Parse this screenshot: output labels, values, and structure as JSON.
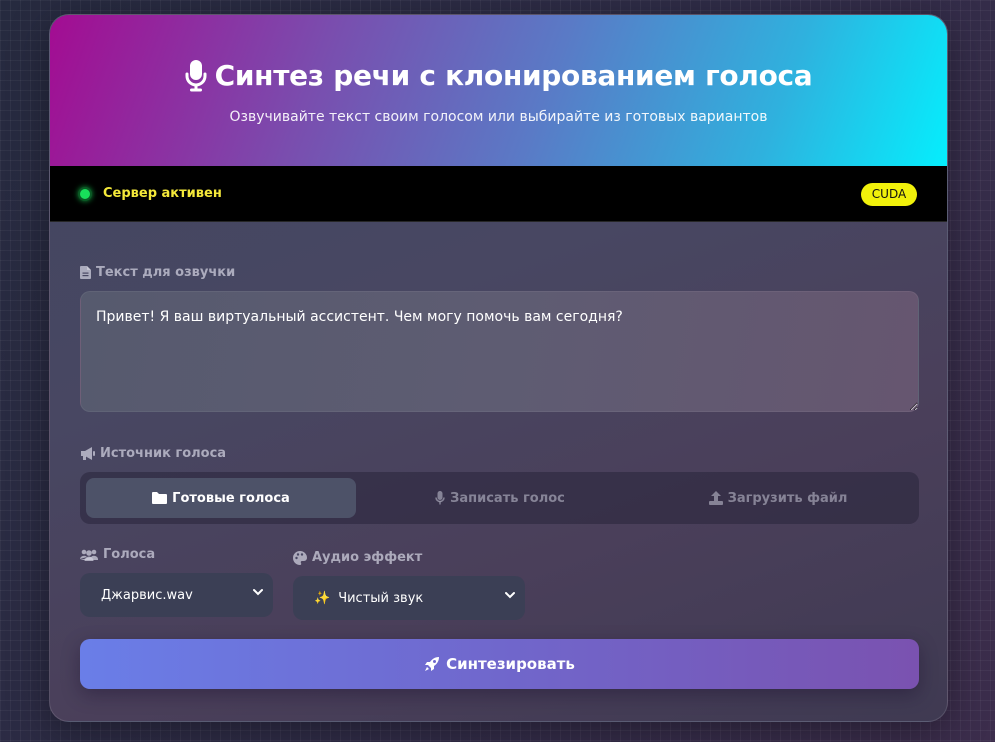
{
  "header": {
    "title": "Синтез речи с клонированием голоса",
    "subtitle": "Озвучивайте текст своим голосом или выбирайте из готовых вариантов"
  },
  "status": {
    "text": "Сервер активен",
    "device_badge": "CUDA",
    "indicator_color": "#18e05a"
  },
  "text_section": {
    "label": "Текст для озвучки",
    "value": "Привет! Я ваш виртуальный ассистент. Чем могу помочь вам сегодня?"
  },
  "voice_source": {
    "label": "Источник голоса",
    "tabs": [
      {
        "label": "Готовые голоса",
        "icon": "folder-icon",
        "active": true
      },
      {
        "label": "Записать голос",
        "icon": "microphone-icon",
        "active": false
      },
      {
        "label": "Загрузить файл",
        "icon": "upload-icon",
        "active": false
      }
    ]
  },
  "voices": {
    "label": "Голоса",
    "selected": "Джарвис.wav"
  },
  "effect": {
    "label": "Аудио эффект",
    "selected_icon": "✨",
    "selected": "Чистый звук"
  },
  "synthesize_button": {
    "label": "Синтезировать",
    "icon": "rocket-icon"
  }
}
